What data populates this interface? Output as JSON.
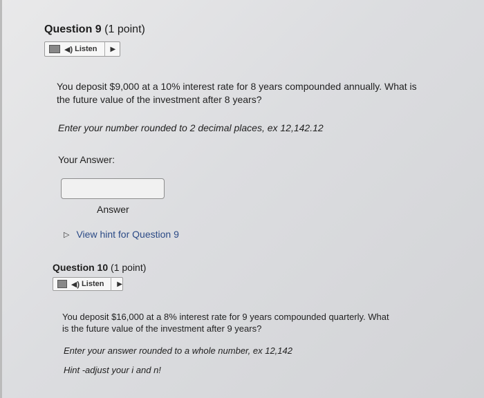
{
  "q9": {
    "title": "Question 9",
    "points": "(1 point)",
    "listen_label": "Listen",
    "prompt_line1": "You deposit $9,000 at a 10% interest rate for 8 years compounded annually. What is",
    "prompt_line2": "the future value of the investment after 8 years?",
    "instruction": "Enter your number rounded to 2 decimal places, ex 12,142.12",
    "your_answer_label": "Your Answer:",
    "answer_value": "",
    "answer_caption": "Answer",
    "hint_link": "View hint for Question 9"
  },
  "q10": {
    "title": "Question 10",
    "points": "(1 point)",
    "listen_label": "Listen",
    "prompt_line1": "You deposit $16,000 at a 8% interest rate for 9 years compounded quarterly. What",
    "prompt_line2": "is the future value of the investment after 9 years?",
    "instruction": "Enter your answer rounded to a whole number, ex 12,142",
    "hint": "Hint -adjust your i and n!"
  },
  "icons": {
    "speaker": "speaker-icon",
    "play": "play-icon",
    "device": "device-icon",
    "expand": "triangle-right-icon"
  }
}
